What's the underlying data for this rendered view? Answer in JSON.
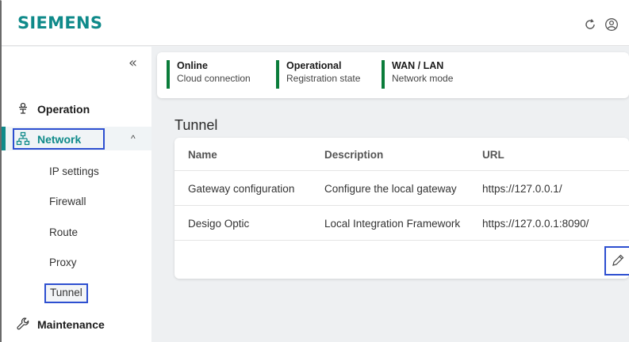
{
  "header": {
    "logo": "SIEMENS",
    "icons": [
      "refresh-icon",
      "user-icon"
    ]
  },
  "sidebar": {
    "collapse_icon": "«",
    "items": [
      {
        "label": "Operation",
        "icon": "operation-icon"
      },
      {
        "label": "Network",
        "icon": "network-icon",
        "expanded": true
      },
      {
        "label": "Maintenance",
        "icon": "wrench-icon"
      }
    ],
    "network_sub": [
      "IP settings",
      "Firewall",
      "Route",
      "Proxy",
      "Tunnel"
    ],
    "chevron": "^"
  },
  "status": [
    {
      "title": "Online",
      "sub": "Cloud connection"
    },
    {
      "title": "Operational",
      "sub": "Registration state"
    },
    {
      "title": "WAN / LAN",
      "sub": "Network mode"
    }
  ],
  "page": {
    "title": "Tunnel"
  },
  "table": {
    "headers": [
      "Name",
      "Description",
      "URL"
    ],
    "rows": [
      [
        "Gateway configuration",
        "Configure the local gateway",
        "https://127.0.0.1/"
      ],
      [
        "Desigo Optic",
        "Local Integration Framework",
        "https://127.0.0.1:8090/"
      ]
    ]
  },
  "colors": {
    "brand": "#0f8a8a",
    "status_ok": "#0a7c3a",
    "highlight": "#2d4fd0"
  }
}
